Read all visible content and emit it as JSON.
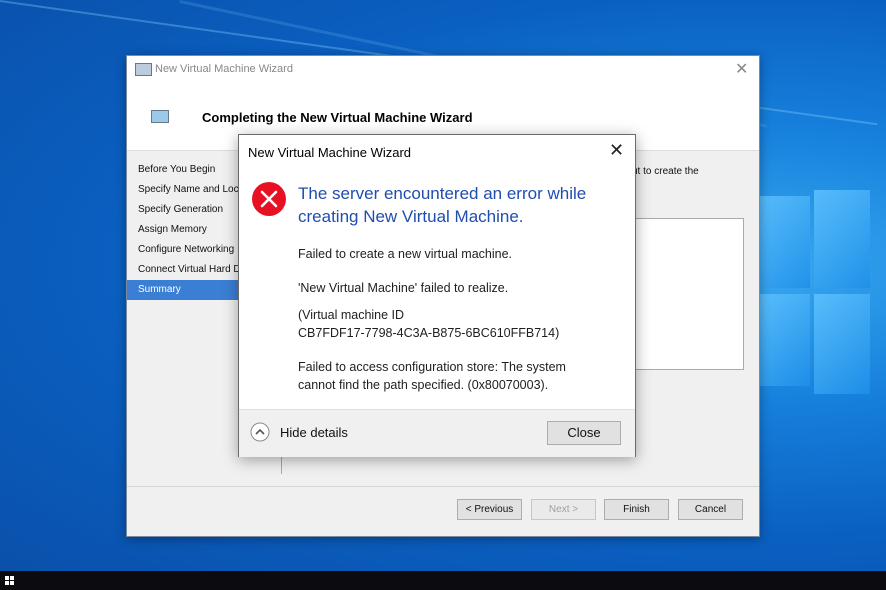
{
  "wizard": {
    "title": "New Virtual Machine Wizard",
    "heading": "Completing the New Virtual Machine Wizard",
    "description_fragment": "ut to create the",
    "nav": [
      {
        "label": "Before You Begin"
      },
      {
        "label": "Specify Name and Loca"
      },
      {
        "label": "Specify Generation"
      },
      {
        "label": "Assign Memory"
      },
      {
        "label": "Configure Networking"
      },
      {
        "label": "Connect Virtual Hard Di"
      },
      {
        "label": "Summary"
      }
    ],
    "buttons": {
      "previous": "< Previous",
      "next": "Next >",
      "finish": "Finish",
      "cancel": "Cancel"
    }
  },
  "dialog": {
    "title": "New Virtual Machine Wizard",
    "main_instruction": "The server encountered an error while creating New Virtual Machine.",
    "lines": {
      "l1": "Failed to create a new virtual machine.",
      "l2": "'New Virtual Machine' failed to realize.",
      "l3a": "(Virtual machine ID",
      "l3b": "CB7FDF17-7798-4C3A-B875-6BC610FFB714)",
      "l4a": "Failed to access configuration store: The system",
      "l4b": "cannot find the path specified. (0x80070003)."
    },
    "hide_details": "Hide details",
    "close": "Close",
    "icon": "error-icon",
    "colors": {
      "instruction": "#1f4db0",
      "error": "#e81123"
    }
  },
  "taskbar": {
    "start_icon": "windows-start-icon"
  }
}
